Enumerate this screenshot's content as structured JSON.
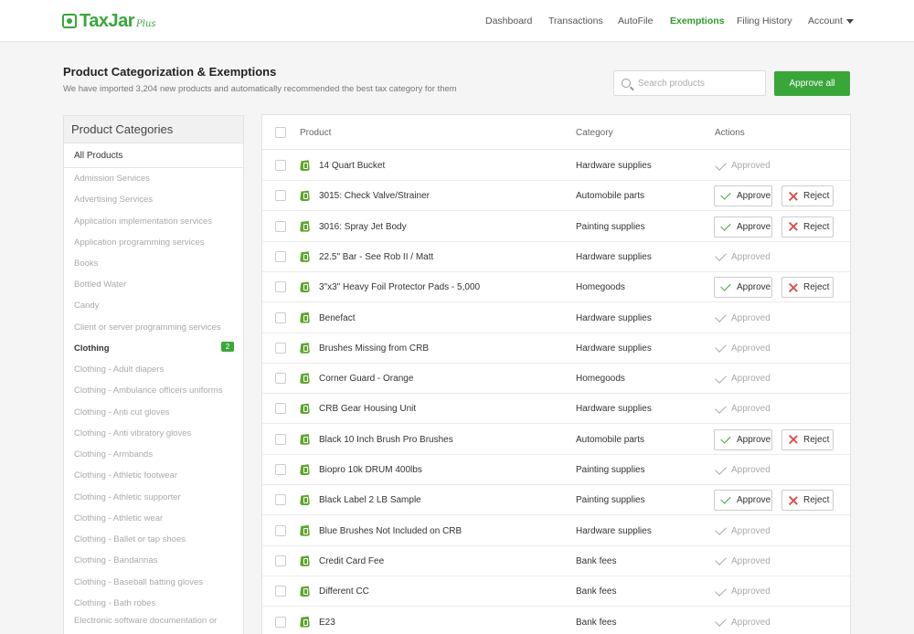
{
  "brand": {
    "name": "TaxJar",
    "suffix": "Plus"
  },
  "nav": {
    "items": [
      {
        "label": "Dashboard"
      },
      {
        "label": "Transactions"
      },
      {
        "label": "AutoFile"
      },
      {
        "label": "Exemptions"
      },
      {
        "label": "Filing History"
      },
      {
        "label": "Account"
      }
    ],
    "active": "Exemptions"
  },
  "page": {
    "title": "Product Categorization & Exemptions",
    "subtitle": "We have imported 3,204 new products and automatically recommended the best tax category for them"
  },
  "search": {
    "placeholder": "Search products",
    "value": ""
  },
  "approve_all_label": "Approve all",
  "categories": {
    "heading": "Product Categories",
    "all_label": "All Products",
    "items": [
      {
        "label": "Admission Services"
      },
      {
        "label": "Advertising Services"
      },
      {
        "label": "Application implementation services"
      },
      {
        "label": "Application programming services"
      },
      {
        "label": "Books"
      },
      {
        "label": "Bottled Water"
      },
      {
        "label": "Candy"
      },
      {
        "label": "Client or server programming services"
      },
      {
        "label": "Clothing",
        "badge": "2"
      },
      {
        "label": "Clothing - Adult diapers"
      },
      {
        "label": "Clothing - Ambulance officers uniforms"
      },
      {
        "label": "Clothing - Anti cut gloves"
      },
      {
        "label": "Clothing - Anti vibratory gloves"
      },
      {
        "label": "Clothing - Armbands"
      },
      {
        "label": "Clothing - Athletic footwear"
      },
      {
        "label": "Clothing - Athletic supporter"
      },
      {
        "label": "Clothing - Athletic wear"
      },
      {
        "label": "Clothing - Ballet or tap shoes"
      },
      {
        "label": "Clothing - Bandannas"
      },
      {
        "label": "Clothing - Baseball batting gloves"
      },
      {
        "label": "Clothing - Bath robes"
      },
      {
        "label": "Electronic software documentation or"
      }
    ]
  },
  "table": {
    "columns": {
      "product": "Product",
      "category": "Category",
      "actions": "Actions"
    },
    "approve_label": "Approve",
    "reject_label": "Reject",
    "approved_label": "Approved",
    "rows": [
      {
        "product": "14 Quart Bucket",
        "category": "Hardware supplies",
        "status": "approved"
      },
      {
        "product": "3015: Check Valve/Strainer",
        "category": "Automobile parts",
        "status": "pending"
      },
      {
        "product": "3016: Spray Jet Body",
        "category": "Painting supplies",
        "status": "pending"
      },
      {
        "product": "22.5\" Bar - See Rob II / Matt",
        "category": "Hardware supplies",
        "status": "approved"
      },
      {
        "product": "3\"x3\" Heavy Foil Protector Pads - 5,000",
        "category": "Homegoods",
        "status": "pending"
      },
      {
        "product": "Benefact",
        "category": "Hardware supplies",
        "status": "approved"
      },
      {
        "product": "Brushes Missing from CRB",
        "category": "Hardware supplies",
        "status": "approved"
      },
      {
        "product": "Corner Guard - Orange",
        "category": "Homegoods",
        "status": "approved"
      },
      {
        "product": "CRB Gear Housing Unit",
        "category": "Hardware supplies",
        "status": "approved"
      },
      {
        "product": "Black 10 Inch Brush Pro Brushes",
        "category": "Automobile parts",
        "status": "pending"
      },
      {
        "product": "Biopro 10k DRUM 400lbs",
        "category": "Painting supplies",
        "status": "approved"
      },
      {
        "product": "Black Label 2 LB Sample",
        "category": "Painting supplies",
        "status": "pending"
      },
      {
        "product": "Blue Brushes Not Included on CRB",
        "category": "Hardware supplies",
        "status": "approved"
      },
      {
        "product": "Credit Card Fee",
        "category": "Bank fees",
        "status": "approved"
      },
      {
        "product": "Different CC",
        "category": "Bank fees",
        "status": "approved"
      },
      {
        "product": "E23",
        "category": "Bank fees",
        "status": "approved"
      }
    ]
  },
  "colors": {
    "accent": "#3aa63a",
    "reject": "#d9534f"
  }
}
